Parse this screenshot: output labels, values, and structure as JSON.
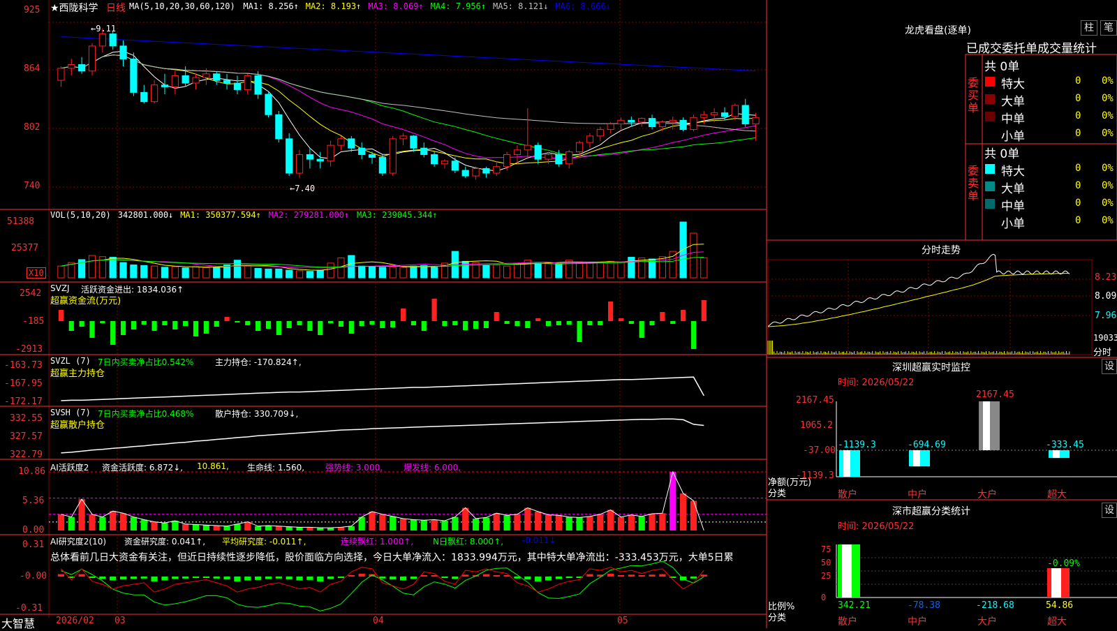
{
  "app": {
    "brand": "大智慧"
  },
  "stock": {
    "title": "★西陇科学",
    "period": "日线"
  },
  "colors": {
    "up": "#ff2020",
    "down": "#00ffff",
    "vol_down": "#00ffff",
    "ma5": "#ffffff",
    "ma10": "#ffff00",
    "ma20": "#ff00ff",
    "ma30": "#00ff00",
    "ma60": "#c0c0c0",
    "ma120": "#0000ff",
    "grid": "#8b0000",
    "axis": "#ff3030"
  },
  "main_legend": [
    {
      "text": "MA(5,10,20,30,60,120)",
      "color": "#ffffff"
    },
    {
      "text": "MA1: 8.256↑",
      "color": "#ffffff"
    },
    {
      "text": "MA2: 8.193↑",
      "color": "#ffff00"
    },
    {
      "text": "MA3: 8.069↑",
      "color": "#ff00ff"
    },
    {
      "text": "MA4: 7.956↑",
      "color": "#00ff00"
    },
    {
      "text": "MA5: 8.121↓",
      "color": "#c0c0c0"
    },
    {
      "text": "MA6: 8.666↓",
      "color": "#0000ff"
    }
  ],
  "price_axis": [
    "925",
    "864",
    "802",
    "740"
  ],
  "annotations": {
    "high": "←9.11",
    "low": "←7.40"
  },
  "vol_panel": {
    "legend": [
      {
        "text": "VOL(5,10,20)",
        "color": "#ffffff"
      },
      {
        "text": "342801.000↓",
        "color": "#ffffff"
      },
      {
        "text": "MA1: 350377.594↑",
        "color": "#ffff00"
      },
      {
        "text": "MA2: 279281.000↑",
        "color": "#ff00ff"
      },
      {
        "text": "MA3: 239045.344↑",
        "color": "#00ff00"
      }
    ],
    "axis": [
      "51388",
      "25377"
    ],
    "unit": "X10"
  },
  "svzj_panel": {
    "legend": [
      {
        "text": "SVZJ",
        "color": "#ffffff"
      },
      {
        "text": "活跃资金进出: 1834.036↑",
        "color": "#ffffff"
      }
    ],
    "subtitle": "超赢资金流(万元)",
    "axis": [
      "2542",
      "-185",
      "-2913"
    ]
  },
  "svzl_panel": {
    "legend": [
      {
        "text": "SVZL (7)",
        "color": "#ffffff"
      },
      {
        "text": "7日内买卖净占比0.542%",
        "color": "#00ff00"
      },
      {
        "text": "主力持仓: -170.824↑,",
        "color": "#ffffff"
      }
    ],
    "subtitle": "超赢主力持仓",
    "axis": [
      "-163.73",
      "-167.95",
      "-172.17"
    ]
  },
  "svsh_panel": {
    "legend": [
      {
        "text": "SVSH (7)",
        "color": "#ffffff"
      },
      {
        "text": "7日内买卖净占比0.468%",
        "color": "#00ff00"
      },
      {
        "text": "散户持仓: 330.709↓,",
        "color": "#ffffff"
      }
    ],
    "subtitle": "超赢散户持仓",
    "axis": [
      "332.55",
      "327.57",
      "322.79"
    ]
  },
  "ai_panel": {
    "legend": [
      {
        "text": "AI活跃度2",
        "color": "#ffffff"
      },
      {
        "text": "资金活跃度: 6.872↓,",
        "color": "#ffffff"
      },
      {
        "text": "10.861,",
        "color": "#ffff00"
      },
      {
        "text": "生命线: 1.560,",
        "color": "#ffffff"
      },
      {
        "text": "强势线: 3.000,",
        "color": "#ff00ff"
      },
      {
        "text": "爆发线: 6.000,",
        "color": "#ff00ff"
      }
    ],
    "axis": [
      "10.86",
      "5.36",
      "0.00"
    ]
  },
  "research_panel": {
    "legend": [
      {
        "text": "AI研究度2(10)",
        "color": "#ffffff"
      },
      {
        "text": "资金研究度: 0.041↑,",
        "color": "#ffffff"
      },
      {
        "text": "平均研究度: -0.011↑,",
        "color": "#ffff00"
      },
      {
        "text": "连续飘红: 1.000↑,",
        "color": "#ff00ff"
      },
      {
        "text": "N日飘红: 8.000↑,",
        "color": "#00ff00"
      },
      {
        "text": "-0.011↓",
        "color": "#0000ff"
      }
    ],
    "summary": "总体看前几日大资金有关注，但近日持续性逐步降低，股价面临方向选择，今日大单净流入：1833.994万元，其中特大单净流出：-333.453万元，大单5日累",
    "axis": [
      "0.31",
      "-0.00",
      "-0.31"
    ]
  },
  "time_axis": [
    "2026/02",
    "03",
    "04",
    "05"
  ],
  "dragon_tiger": {
    "title": "龙虎看盘(逐单)",
    "btn1": "柱",
    "btn2": "笔",
    "header": "已成交委托单成交量统计",
    "buy_label": "委买单",
    "sell_label": "委卖单",
    "buy": {
      "total": "共 0单",
      "rows": [
        {
          "name": "特大",
          "count": "0",
          "pct": "0%",
          "color": "#ff0000"
        },
        {
          "name": "大单",
          "count": "0",
          "pct": "0%",
          "color": "#8b0000"
        },
        {
          "name": "中单",
          "count": "0",
          "pct": "0%",
          "color": "#6b0000"
        },
        {
          "name": "小单",
          "count": "0",
          "pct": "0%",
          "color": ""
        }
      ]
    },
    "sell": {
      "total": "共 0单",
      "rows": [
        {
          "name": "特大",
          "count": "0",
          "pct": "0%",
          "color": "#00ffff"
        },
        {
          "name": "大单",
          "count": "0",
          "pct": "0%",
          "color": "#008b8b"
        },
        {
          "name": "中单",
          "count": "0",
          "pct": "0%",
          "color": "#006b6b"
        },
        {
          "name": "小单",
          "count": "0",
          "pct": "0%",
          "color": ""
        }
      ]
    }
  },
  "intraday": {
    "title": "分时走势",
    "axis": [
      "8.23",
      "8.09",
      "7.96"
    ],
    "vol_label": "19033",
    "unit": "分时"
  },
  "sz_monitor": {
    "title": "深圳超赢实时监控",
    "btn": "设",
    "time": "时间: 2026/05/22",
    "axis": [
      "2167.45",
      "1065.2",
      "-37.00",
      "-1139.3"
    ],
    "ylabel_1": "净额(万元)",
    "ylabel_2": "分类",
    "chart_data": {
      "type": "bar",
      "categories": [
        "散户",
        "中户",
        "大户",
        "超大"
      ],
      "values": [
        -1139.3,
        -694.69,
        2167.45,
        -333.45
      ],
      "value_labels": [
        "-1139.3",
        "-694.69",
        "2167.45",
        "-333.45"
      ],
      "ylim": [
        -1139.3,
        2167.45
      ]
    }
  },
  "sz_class": {
    "title": "深市超赢分类统计",
    "btn": "设",
    "time": "时间: 2026/05/22",
    "axis": [
      "75",
      "50",
      "25",
      "0"
    ],
    "ylabel_1": "比例%",
    "ylabel_2": "分类",
    "top_label": "-0.09%",
    "chart_data": {
      "type": "bar",
      "categories": [
        "散户",
        "中户",
        "大户",
        "超大"
      ],
      "values": [
        342.21,
        -78.38,
        -218.68,
        54.86
      ],
      "value_labels": [
        "342.21",
        "-78.38",
        "-218.68",
        "54.86"
      ],
      "ylim": [
        0,
        75
      ]
    }
  },
  "chart_data": {
    "type": "candlestick",
    "title": "西陇科学 日线",
    "ylim": [
      7.4,
      9.25
    ],
    "high_mark": 9.11,
    "low_mark": 7.4,
    "x_labels": [
      "2026/02",
      "03",
      "04",
      "05"
    ],
    "ohlc": [
      [
        8.55,
        8.7,
        8.48,
        8.68
      ],
      [
        8.68,
        8.78,
        8.6,
        8.72
      ],
      [
        8.72,
        8.8,
        8.62,
        8.65
      ],
      [
        8.65,
        8.95,
        8.6,
        8.92
      ],
      [
        8.92,
        9.11,
        8.85,
        9.05
      ],
      [
        9.05,
        9.08,
        8.88,
        8.92
      ],
      [
        8.92,
        8.98,
        8.7,
        8.78
      ],
      [
        8.78,
        8.85,
        8.38,
        8.42
      ],
      [
        8.42,
        8.5,
        8.3,
        8.32
      ],
      [
        8.32,
        8.55,
        8.3,
        8.5
      ],
      [
        8.5,
        8.62,
        8.4,
        8.48
      ],
      [
        8.48,
        8.65,
        8.4,
        8.6
      ],
      [
        8.6,
        8.7,
        8.48,
        8.52
      ],
      [
        8.52,
        8.62,
        8.45,
        8.58
      ],
      [
        8.58,
        8.68,
        8.5,
        8.62
      ],
      [
        8.62,
        8.65,
        8.5,
        8.55
      ],
      [
        8.55,
        8.62,
        8.45,
        8.52
      ],
      [
        8.52,
        8.6,
        8.4,
        8.45
      ],
      [
        8.45,
        8.62,
        8.4,
        8.6
      ],
      [
        8.6,
        8.65,
        8.35,
        8.4
      ],
      [
        8.4,
        8.42,
        8.15,
        8.18
      ],
      [
        8.18,
        8.22,
        7.88,
        7.92
      ],
      [
        7.92,
        7.98,
        7.52,
        7.55
      ],
      [
        7.55,
        7.8,
        7.5,
        7.75
      ],
      [
        7.75,
        7.82,
        7.6,
        7.7
      ],
      [
        7.7,
        7.78,
        7.6,
        7.68
      ],
      [
        7.68,
        7.9,
        7.62,
        7.85
      ],
      [
        7.85,
        7.95,
        7.8,
        7.92
      ],
      [
        7.92,
        7.95,
        7.78,
        7.82
      ],
      [
        7.82,
        7.88,
        7.7,
        7.75
      ],
      [
        7.75,
        7.78,
        7.65,
        7.72
      ],
      [
        7.72,
        7.75,
        7.52,
        7.55
      ],
      [
        7.55,
        7.95,
        7.52,
        7.92
      ],
      [
        7.92,
        7.98,
        7.85,
        7.95
      ],
      [
        7.95,
        7.96,
        7.78,
        7.82
      ],
      [
        7.82,
        7.88,
        7.72,
        7.75
      ],
      [
        7.75,
        7.78,
        7.62,
        7.65
      ],
      [
        7.65,
        7.7,
        7.6,
        7.68
      ],
      [
        7.68,
        7.72,
        7.55,
        7.58
      ],
      [
        7.58,
        7.62,
        7.5,
        7.52
      ],
      [
        7.52,
        7.62,
        7.48,
        7.6
      ],
      [
        7.6,
        7.62,
        7.5,
        7.55
      ],
      [
        7.55,
        7.68,
        7.52,
        7.62
      ],
      [
        7.62,
        7.78,
        7.58,
        7.75
      ],
      [
        7.75,
        7.85,
        7.65,
        7.8
      ],
      [
        7.8,
        8.25,
        7.7,
        7.85
      ],
      [
        7.85,
        7.88,
        7.65,
        7.7
      ],
      [
        7.7,
        7.78,
        7.65,
        7.75
      ],
      [
        7.75,
        7.8,
        7.62,
        7.65
      ],
      [
        7.65,
        7.8,
        7.6,
        7.78
      ],
      [
        7.78,
        7.9,
        7.72,
        7.88
      ],
      [
        7.88,
        7.98,
        7.82,
        7.95
      ],
      [
        7.95,
        8.05,
        7.9,
        8.02
      ],
      [
        8.02,
        8.1,
        7.98,
        8.08
      ],
      [
        8.08,
        8.15,
        8.02,
        8.12
      ],
      [
        8.12,
        8.16,
        8.05,
        8.1
      ],
      [
        8.1,
        8.15,
        8.05,
        8.14
      ],
      [
        8.14,
        8.18,
        8.02,
        8.05
      ],
      [
        8.05,
        8.12,
        8.0,
        8.1
      ],
      [
        8.1,
        8.16,
        8.02,
        8.12
      ],
      [
        8.12,
        8.15,
        8.0,
        8.02
      ],
      [
        8.02,
        8.18,
        8.0,
        8.15
      ],
      [
        8.15,
        8.22,
        8.08,
        8.18
      ],
      [
        8.18,
        8.25,
        8.1,
        8.2
      ],
      [
        8.2,
        8.26,
        8.12,
        8.16
      ],
      [
        8.16,
        8.3,
        8.12,
        8.28
      ],
      [
        8.28,
        8.35,
        8.05,
        8.08
      ],
      [
        8.08,
        8.2,
        7.9,
        8.15
      ]
    ],
    "volume": [
      2.0,
      2.6,
      3.1,
      3.8,
      3.6,
      3.5,
      2.6,
      2.2,
      2.1,
      2.0,
      1.8,
      1.9,
      1.7,
      1.9,
      1.7,
      1.8,
      2.2,
      3.0,
      2.0,
      1.6,
      1.5,
      1.5,
      1.3,
      1.2,
      1.1,
      1.3,
      2.5,
      3.4,
      3.8,
      2.0,
      1.9,
      1.8,
      1.8,
      1.8,
      2.0,
      2.1,
      1.8,
      2.5,
      4.5,
      2.8,
      2.6,
      2.1,
      2.2,
      2.0,
      2.5,
      3.0,
      2.5,
      2.6,
      2.4,
      3.0,
      2.7,
      2.6,
      2.7,
      2.8,
      2.6,
      3.5,
      3.4,
      3.2,
      3.6,
      4.5,
      9.5,
      7.6,
      3.4
    ],
    "svzj": [
      800,
      -700,
      -400,
      -1200,
      -150,
      -1700,
      -1000,
      -600,
      -250,
      -700,
      -300,
      -600,
      -350,
      -1100,
      -900,
      -400,
      300,
      -100,
      -300,
      -700,
      -550,
      -1000,
      -500,
      -300,
      -700,
      -1000,
      -150,
      -400,
      -900,
      -350,
      -250,
      -500,
      -450,
      900,
      -300,
      -700,
      1600,
      -350,
      -300,
      -650,
      -550,
      -500,
      650,
      -200,
      -350,
      -500,
      200,
      -350,
      -300,
      -250,
      -1500,
      -300,
      -300,
      1400,
      200,
      -200,
      -1200,
      -300,
      650,
      -200,
      800,
      -2000,
      1500
    ],
    "svzl": [
      -172.0,
      -171.9,
      -171.9,
      -171.8,
      -171.7,
      -171.6,
      -171.5,
      -171.4,
      -171.3,
      -171.2,
      -171.1,
      -171.0,
      -170.9,
      -170.8,
      -170.7,
      -170.6,
      -170.5,
      -170.4,
      -170.3,
      -170.2,
      -170.1,
      -170.0,
      -169.9,
      -169.9,
      -169.8,
      -169.7,
      -169.6,
      -169.5,
      -169.4,
      -169.3,
      -169.2,
      -169.1,
      -169.0,
      -168.9,
      -168.8,
      -168.8,
      -168.7,
      -168.6,
      -168.5,
      -168.4,
      -168.3,
      -168.2,
      -168.1,
      -168.0,
      -167.9,
      -167.8,
      -167.7,
      -167.6,
      -167.5,
      -167.4,
      -167.3,
      -167.2,
      -167.1,
      -167.0,
      -166.9,
      -166.9,
      -166.8,
      -166.7,
      -166.6,
      -166.5,
      -166.4,
      -166.3,
      -170.8
    ],
    "svsh": [
      323.0,
      323.2,
      323.5,
      323.8,
      324.0,
      324.3,
      324.5,
      324.8,
      325.0,
      325.3,
      325.5,
      325.8,
      326.0,
      326.3,
      326.5,
      326.8,
      327.0,
      327.3,
      327.5,
      327.8,
      328.0,
      328.2,
      328.4,
      328.6,
      328.8,
      329.0,
      329.2,
      329.4,
      329.5,
      329.6,
      329.8,
      329.9,
      330.0,
      330.1,
      330.2,
      330.3,
      330.4,
      330.5,
      330.6,
      330.7,
      330.8,
      330.9,
      331.0,
      331.1,
      331.2,
      331.3,
      331.4,
      331.5,
      331.6,
      331.7,
      331.8,
      331.9,
      332.0,
      332.1,
      332.2,
      332.3,
      332.4,
      332.4,
      332.5,
      332.5,
      332.3,
      331.0,
      330.7
    ],
    "ai": [
      3.0,
      2.5,
      5.8,
      3.0,
      2.5,
      3.6,
      3.2,
      2.5,
      2.0,
      1.6,
      1.4,
      1.8,
      1.2,
      1.1,
      1.0,
      0.9,
      0.8,
      1.2,
      1.6,
      0.8,
      0.9,
      0.8,
      0.7,
      0.6,
      0.6,
      0.5,
      0.5,
      0.6,
      0.8,
      2.5,
      3.5,
      3.0,
      2.6,
      2.2,
      2.0,
      1.9,
      2.0,
      1.8,
      2.5,
      4.2,
      2.2,
      2.4,
      3.2,
      2.8,
      3.0,
      4.2,
      3.5,
      2.9,
      2.8,
      2.5,
      2.4,
      2.6,
      3.0,
      3.8,
      2.5,
      2.9,
      2.6,
      3.1,
      3.2,
      10.86,
      6.87,
      5.5,
      0
    ],
    "research": [
      0.05,
      -0.02,
      0.05,
      -0.03,
      -0.05,
      -0.08,
      -0.06,
      -0.05,
      -0.04,
      -0.1,
      -0.08,
      -0.05,
      -0.04,
      -0.03,
      -0.02,
      -0.04,
      -0.06,
      -0.1,
      -0.08,
      -0.07,
      -0.05,
      -0.04,
      -0.06,
      -0.08,
      -0.07,
      -0.1,
      -0.05,
      -0.03,
      0.03,
      0.06,
      0.05,
      -0.04,
      -0.06,
      -0.08,
      -0.05,
      0.03,
      0.02,
      -0.03,
      -0.05,
      0.04,
      0.03,
      0.05,
      0.03,
      0.02,
      -0.04,
      -0.06,
      -0.1,
      -0.08,
      -0.05,
      -0.03,
      -0.02,
      0.05,
      0.04,
      0.06,
      0.03,
      0.04,
      0.02,
      0.04,
      0.05,
      -0.02,
      -0.08,
      -0.04,
      0.04
    ]
  }
}
